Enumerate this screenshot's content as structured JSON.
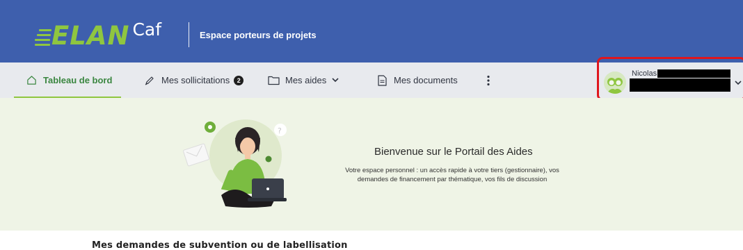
{
  "header": {
    "logo_elan": "ELAN",
    "logo_caf": "Caf",
    "subtitle": "Espace porteurs de projets",
    "background": "#3e5fad",
    "accent": "#8fc640"
  },
  "nav": {
    "items": [
      {
        "label": "Tableau de bord",
        "icon": "home-icon",
        "active": true
      },
      {
        "label": "Mes sollicitations",
        "icon": "pen-icon",
        "badge": "2"
      },
      {
        "label": "Mes aides",
        "icon": "folder-icon",
        "has_dropdown": true
      },
      {
        "label": "Mes documents",
        "icon": "document-icon"
      }
    ],
    "more_icon": "kebab-menu-icon"
  },
  "user": {
    "name": "Nicolas",
    "avatar_icon": "user-avatar-icon",
    "dropdown_icon": "chevron-down-icon"
  },
  "hero": {
    "title": "Bienvenue sur le Portail des Aides",
    "text": "Votre espace personnel : un accès rapide à votre tiers (gestionnaire), vos demandes de financement par thématique, vos fils de discussion",
    "illustration": "woman-with-laptop-illustration",
    "background": "#eff4e6"
  },
  "section": {
    "title": "Mes demandes de subvention ou de labellisation"
  }
}
